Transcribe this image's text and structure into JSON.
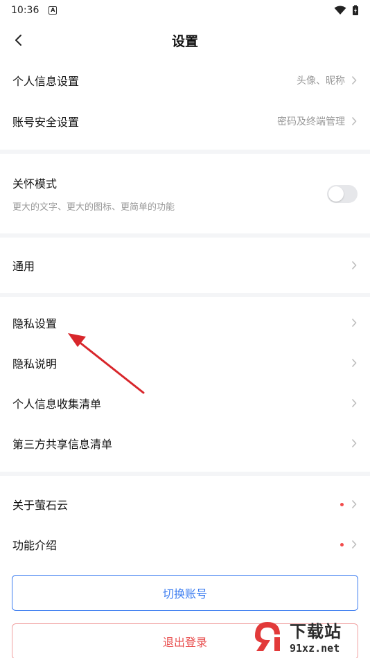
{
  "status": {
    "time": "10:36",
    "a_badge": "A"
  },
  "header": {
    "title": "设置"
  },
  "section1": [
    {
      "label": "个人信息设置",
      "value": "头像、昵称"
    },
    {
      "label": "账号安全设置",
      "value": "密码及终端管理"
    }
  ],
  "care": {
    "title": "关怀模式",
    "subtitle": "更大的文字、更大的图标、更简单的功能",
    "enabled": false
  },
  "section3": [
    {
      "label": "通用"
    }
  ],
  "section4": [
    {
      "label": "隐私设置"
    },
    {
      "label": "隐私说明"
    },
    {
      "label": "个人信息收集清单"
    },
    {
      "label": "第三方共享信息清单"
    }
  ],
  "section5": [
    {
      "label": "关于萤石云",
      "dot": true
    },
    {
      "label": "功能介绍",
      "dot": true
    }
  ],
  "buttons": {
    "switch_account": "切换账号",
    "logout": "退出登录"
  },
  "watermark": {
    "big": "下载站",
    "small": "91xz.net"
  },
  "colors": {
    "accent_blue": "#3b7cf0",
    "danger_red": "#e84c4c",
    "dot_red": "#f24b4b",
    "divider": "#f4f5f7",
    "arrow": "#d8262b"
  }
}
